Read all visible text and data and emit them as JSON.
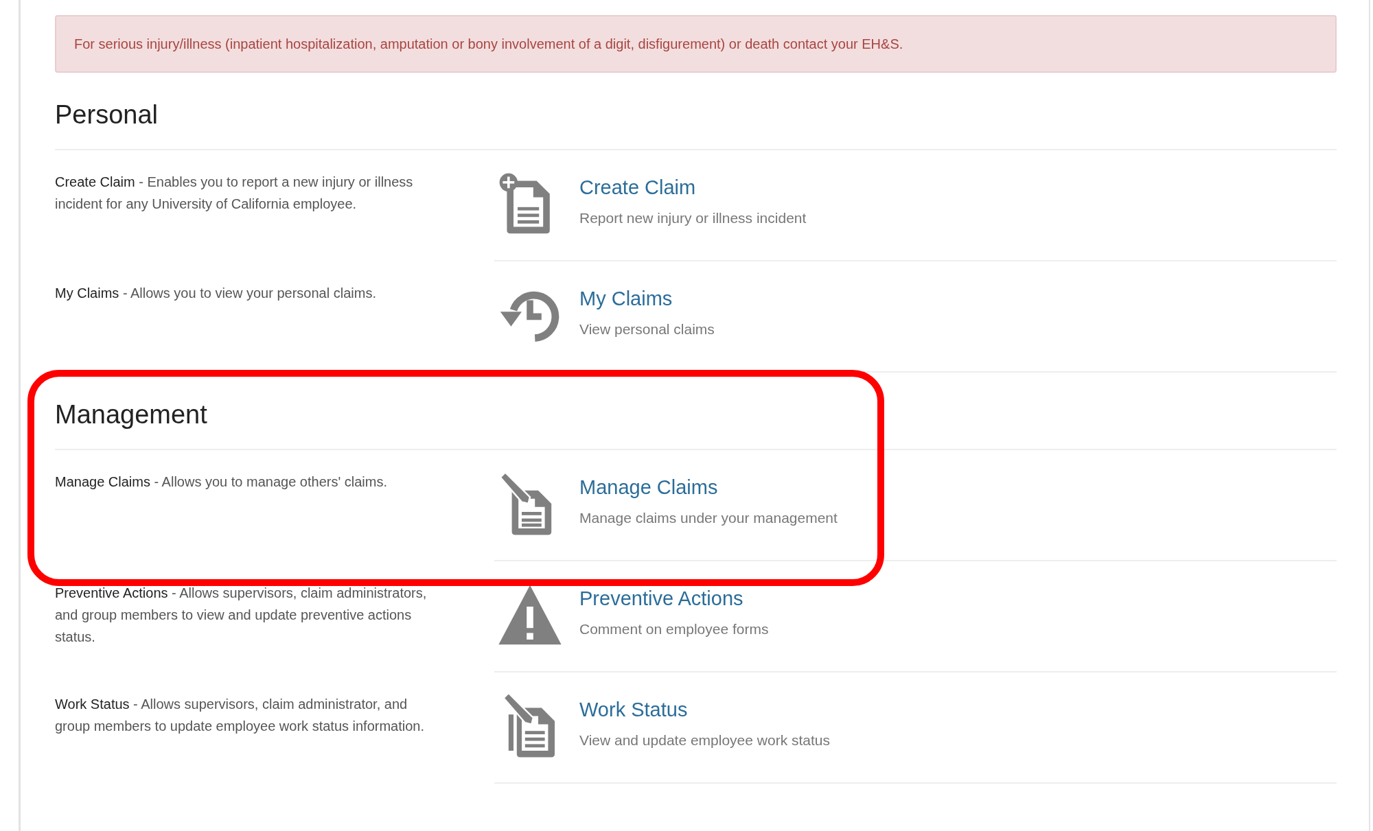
{
  "alert": {
    "text": "For serious injury/illness (inpatient hospitalization, amputation or bony involvement of a digit, disfigurement) or death contact your EH&S."
  },
  "sections": [
    {
      "title": "Personal",
      "highlighted": false,
      "items": [
        {
          "description": "**Create Claim** - Enables you to report a new injury or illness incident for any University of California employee.",
          "title": "Create Claim",
          "subtitle": "Report new injury or illness incident"
        },
        {
          "description": "**My Claims** - Allows you to view your personal claims.",
          "title": "My Claims",
          "subtitle": "View personal claims"
        }
      ]
    },
    {
      "title": "Management",
      "highlighted": true,
      "items": [
        {
          "description": "**Manage Claims** - Allows you to manage others' claims.",
          "title": "Manage Claims",
          "subtitle": "Manage claims under your management"
        },
        {
          "description": "**Preventive Actions** - Allows supervisors, claim administrators, and group members to view and update preventive actions status.",
          "title": "Preventive Actions",
          "subtitle": "Comment on employee forms"
        },
        {
          "description": "**Work Status** - Allows supervisors, claim administrator, and group members to update employee work status information.",
          "title": "Work Status",
          "subtitle": "View and update employee work status"
        }
      ]
    }
  ]
}
